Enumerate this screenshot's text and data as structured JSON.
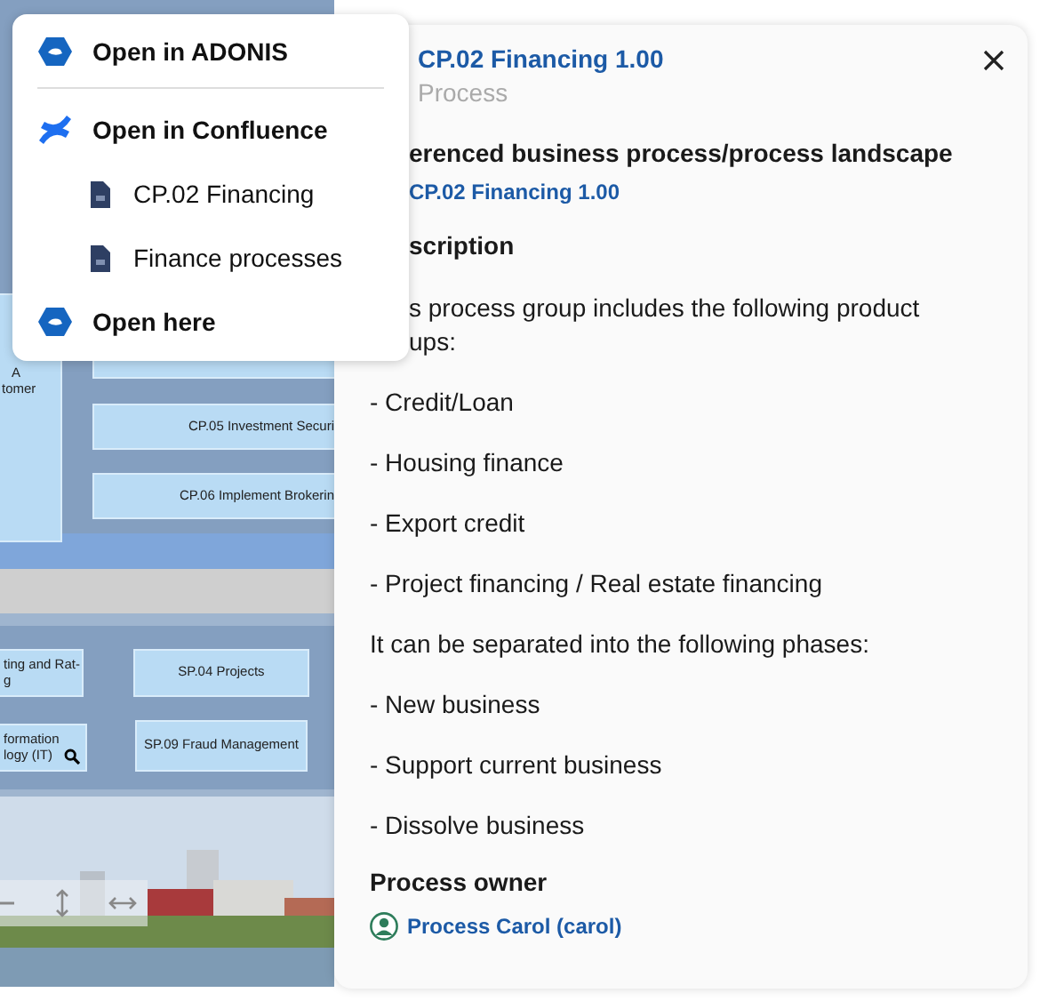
{
  "diagram": {
    "boxes": [
      {
        "lines": [
          "A",
          "tomer"
        ],
        "search": false
      },
      {
        "search": false
      },
      {
        "lines": [
          "CP.05 Investment Securi"
        ],
        "search": false
      },
      {
        "lines": [
          "CP.06 Implement Brokerin"
        ],
        "search": false
      },
      {
        "lines": [
          "ting and Rat-",
          "g"
        ],
        "search": false
      },
      {
        "lines": [
          "SP.04 Projects"
        ],
        "search": false
      },
      {
        "lines": [
          "formation",
          "logy (IT)"
        ],
        "search": true
      },
      {
        "lines": [
          "SP.09 Fraud Management"
        ],
        "search": false
      }
    ]
  },
  "panel": {
    "title": "CP.02 Financing 1.00",
    "type": "Process",
    "sections": [
      {
        "kind": "link",
        "heading": "erenced business process/process landscape",
        "heading_covered": true,
        "link": "CP.02 Financing 1.00",
        "link_covered": true
      },
      {
        "kind": "text",
        "heading": "scription",
        "heading_covered": true,
        "paragraphs": [
          {
            "lines": [
              "s process group includes the following product",
              "ups:"
            ],
            "covered": true
          },
          {
            "lines": [
              "- Credit/Loan"
            ],
            "covered": false
          },
          {
            "lines": [
              "- Housing finance"
            ],
            "covered": false
          },
          {
            "lines": [
              "- Export credit"
            ],
            "covered": false
          },
          {
            "lines": [
              "- Project financing / Real estate financing"
            ],
            "covered": false
          },
          {
            "lines": [
              "It can be separated into the following phases:"
            ],
            "covered": false
          },
          {
            "lines": [
              "- New business"
            ],
            "covered": false
          },
          {
            "lines": [
              "- Support current business"
            ],
            "covered": false
          },
          {
            "lines": [
              "- Dissolve business"
            ],
            "covered": false
          }
        ]
      },
      {
        "kind": "person",
        "heading": "Process owner",
        "heading_covered": false,
        "person": "Process Carol (carol)"
      }
    ]
  },
  "menu": {
    "items": [
      {
        "kind": "adonis",
        "label": "Open in ADONIS",
        "divider_after": true
      },
      {
        "kind": "confluence",
        "label": "Open in Confluence",
        "divider_after": false
      },
      {
        "kind": "page",
        "label": "CP.02 Financing",
        "divider_after": false
      },
      {
        "kind": "page",
        "label": "Finance processes",
        "divider_after": false
      },
      {
        "kind": "adonis",
        "label": "Open here",
        "divider_after": false
      }
    ]
  }
}
